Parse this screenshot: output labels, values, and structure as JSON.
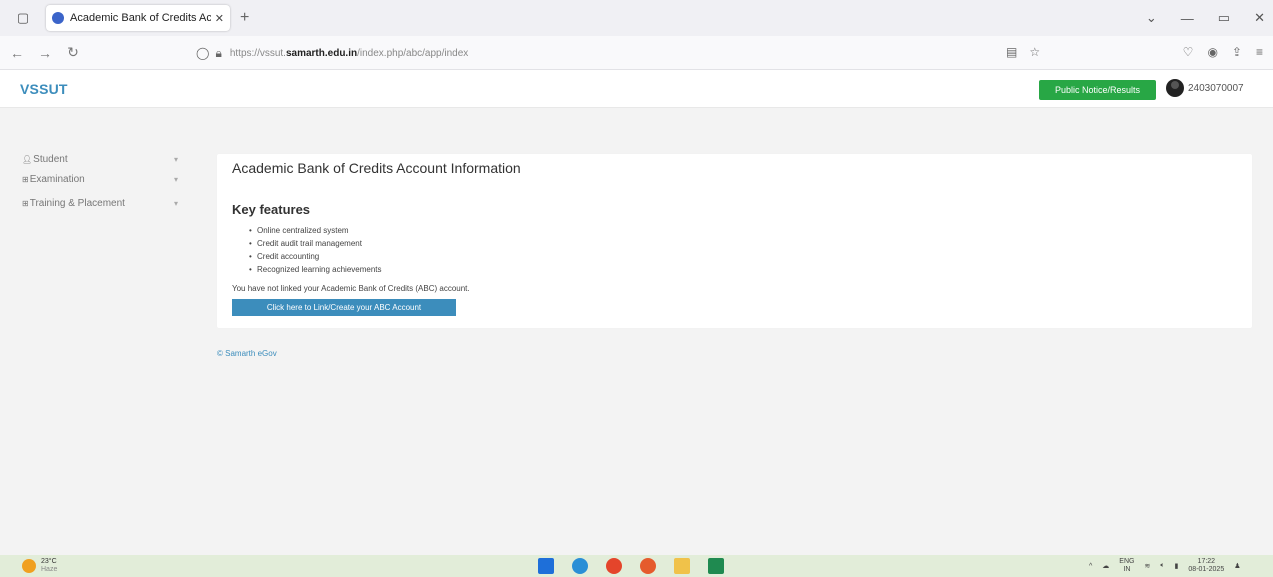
{
  "browser": {
    "tab_title": "Academic Bank of Credits Acco",
    "url_prefix": "https://vssut.",
    "url_host": "samarth.edu.in",
    "url_path": "/index.php/abc/app/index"
  },
  "header": {
    "brand": "VSSUT",
    "notice_button": "Public Notice/Results",
    "user_id": "2403070007"
  },
  "sidebar": {
    "items": [
      {
        "label": "Student",
        "icon": "user-icon"
      },
      {
        "label": "Examination",
        "icon": "grid-icon"
      },
      {
        "label": "Training & Placement",
        "icon": "grid-icon"
      }
    ]
  },
  "main": {
    "page_title": "Academic Bank of Credits Account Information",
    "section_title": "Key features",
    "features": [
      "Online centralized system",
      "Credit audit trail management",
      "Credit accounting",
      "Recognized learning achievements"
    ],
    "notice": "You have not linked your Academic Bank of Credits (ABC) account.",
    "link_button": "Click here to Link/Create your ABC Account",
    "footer": "© Samarth eGov"
  },
  "taskbar": {
    "temperature": "23°C",
    "weather": "Haze",
    "language": "ENG",
    "region": "IN",
    "time": "17:22",
    "date": "08-01-2025"
  },
  "colors": {
    "brand": "#3c8dbc",
    "notice_button": "#28a745",
    "link_button": "#3c8dbc"
  }
}
